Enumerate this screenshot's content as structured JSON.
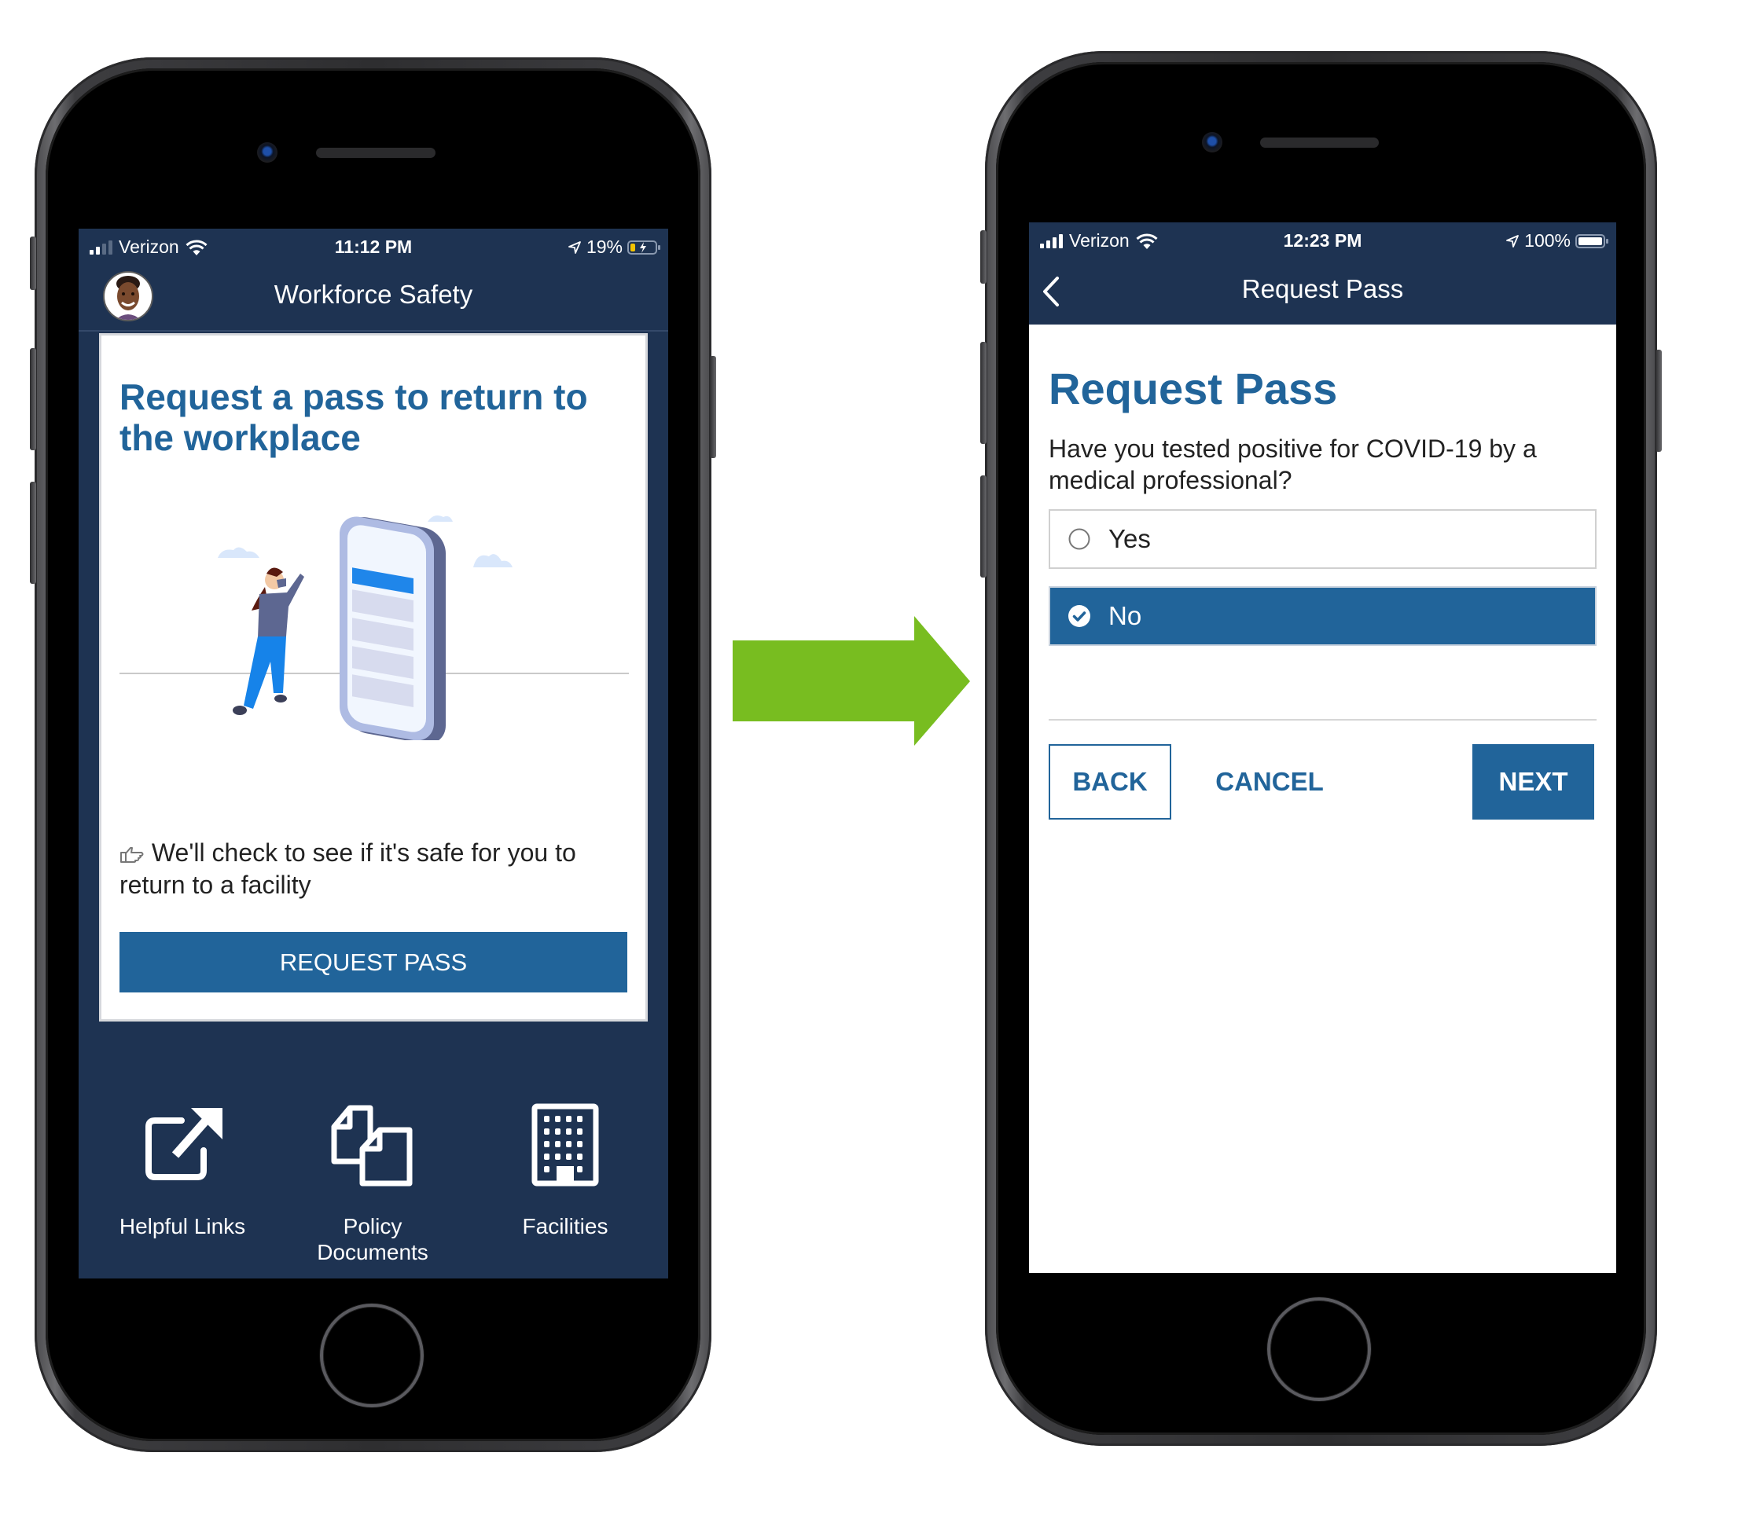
{
  "colors": {
    "nav_bg": "#1e3352",
    "accent_blue": "#21649a",
    "arrow_green": "#78bd20",
    "battery_low": "#f5c400"
  },
  "flow_arrow": {
    "icon": "right-arrow-icon",
    "direction": "right"
  },
  "phone_left": {
    "status": {
      "carrier": "Verizon",
      "time": "11:12 PM",
      "battery": "19%",
      "battery_level": 0.19,
      "charging": true
    },
    "header": {
      "title": "Workforce Safety",
      "avatar": "user-avatar-photo"
    },
    "card": {
      "heading_line1": "Request a pass to return to",
      "heading_line2": "the workplace",
      "illustration": "woman-wearing-mask-using-giant-phone-illustration",
      "info_icon": "thumbs-up-pointing-icon",
      "info_text_line1": "We'll check to see if it's safe for you to",
      "info_text_line2": "return to a facility",
      "button_label": "REQUEST PASS"
    },
    "tiles": [
      {
        "icon": "external-link-icon",
        "label_line1": "Helpful Links",
        "label_line2": ""
      },
      {
        "icon": "documents-icon",
        "label_line1": "Policy",
        "label_line2": "Documents"
      },
      {
        "icon": "building-icon",
        "label_line1": "Facilities",
        "label_line2": ""
      }
    ]
  },
  "phone_right": {
    "status": {
      "carrier": "Verizon",
      "time": "12:23 PM",
      "battery": "100%",
      "battery_level": 1.0,
      "charging": false
    },
    "header": {
      "title": "Request Pass",
      "back_icon": "chevron-left-icon"
    },
    "form": {
      "heading": "Request Pass",
      "question_line1": "Have you tested positive for COVID-19 by a",
      "question_line2": "medical professional?",
      "options": [
        {
          "label": "Yes",
          "selected": false
        },
        {
          "label": "No",
          "selected": true
        }
      ],
      "back_label": "BACK",
      "cancel_label": "CANCEL",
      "next_label": "NEXT"
    }
  }
}
